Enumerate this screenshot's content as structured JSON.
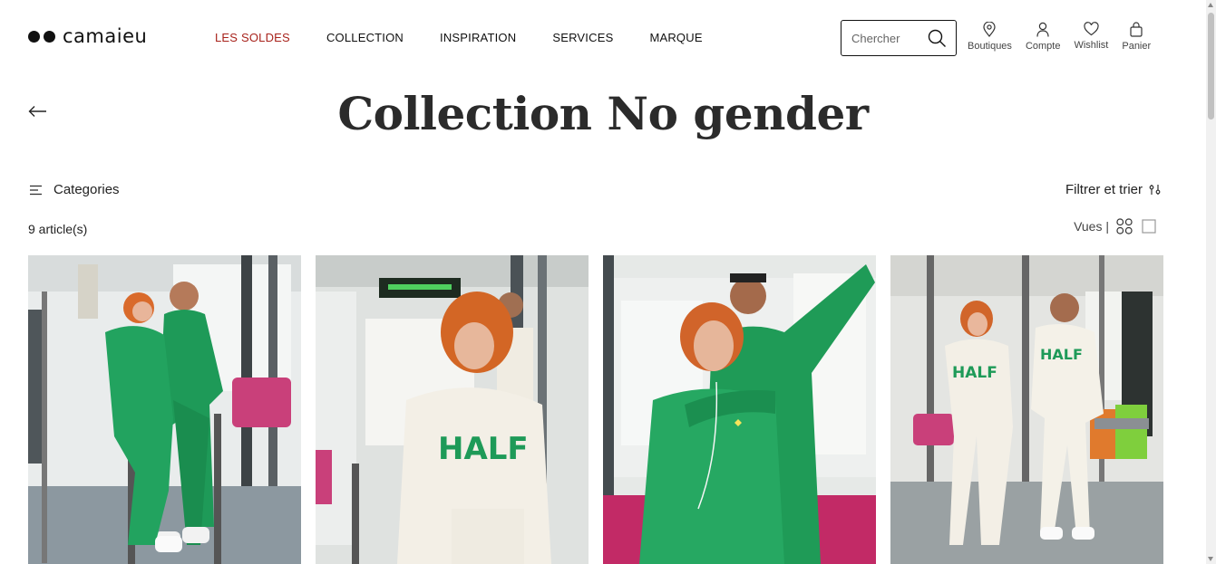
{
  "brand": {
    "name": "camaieu"
  },
  "nav": {
    "items": [
      {
        "label": "LES SOLDES"
      },
      {
        "label": "COLLECTION"
      },
      {
        "label": "INSPIRATION"
      },
      {
        "label": "SERVICES"
      },
      {
        "label": "MARQUE"
      }
    ]
  },
  "search": {
    "placeholder": "Chercher",
    "icon": "search-icon"
  },
  "tools": [
    {
      "label": "Boutiques",
      "icon": "location-pin-icon"
    },
    {
      "label": "Compte",
      "icon": "user-icon"
    },
    {
      "label": "Wishlist",
      "icon": "heart-icon"
    },
    {
      "label": "Panier",
      "icon": "shopping-bag-icon"
    }
  ],
  "page": {
    "title": "Collection No gender",
    "back_icon": "arrow-left-icon"
  },
  "toolbar": {
    "categories_label": "Categories",
    "filter_label": "Filtrer et trier",
    "article_count": "9 article(s)",
    "views_label": "Vues |"
  },
  "colors": {
    "accent_sale": "#a8231c",
    "text": "#1a1a1a",
    "product_green": "#1f9b57",
    "product_cream": "#f3efe6"
  },
  "products": [
    {
      "image": "couple-green-sweatsuits-tram"
    },
    {
      "image": "woman-cream-sweatshirt-tram"
    },
    {
      "image": "couple-embrace-green-sweatshirts"
    },
    {
      "image": "couple-cream-outfits-tram"
    }
  ]
}
